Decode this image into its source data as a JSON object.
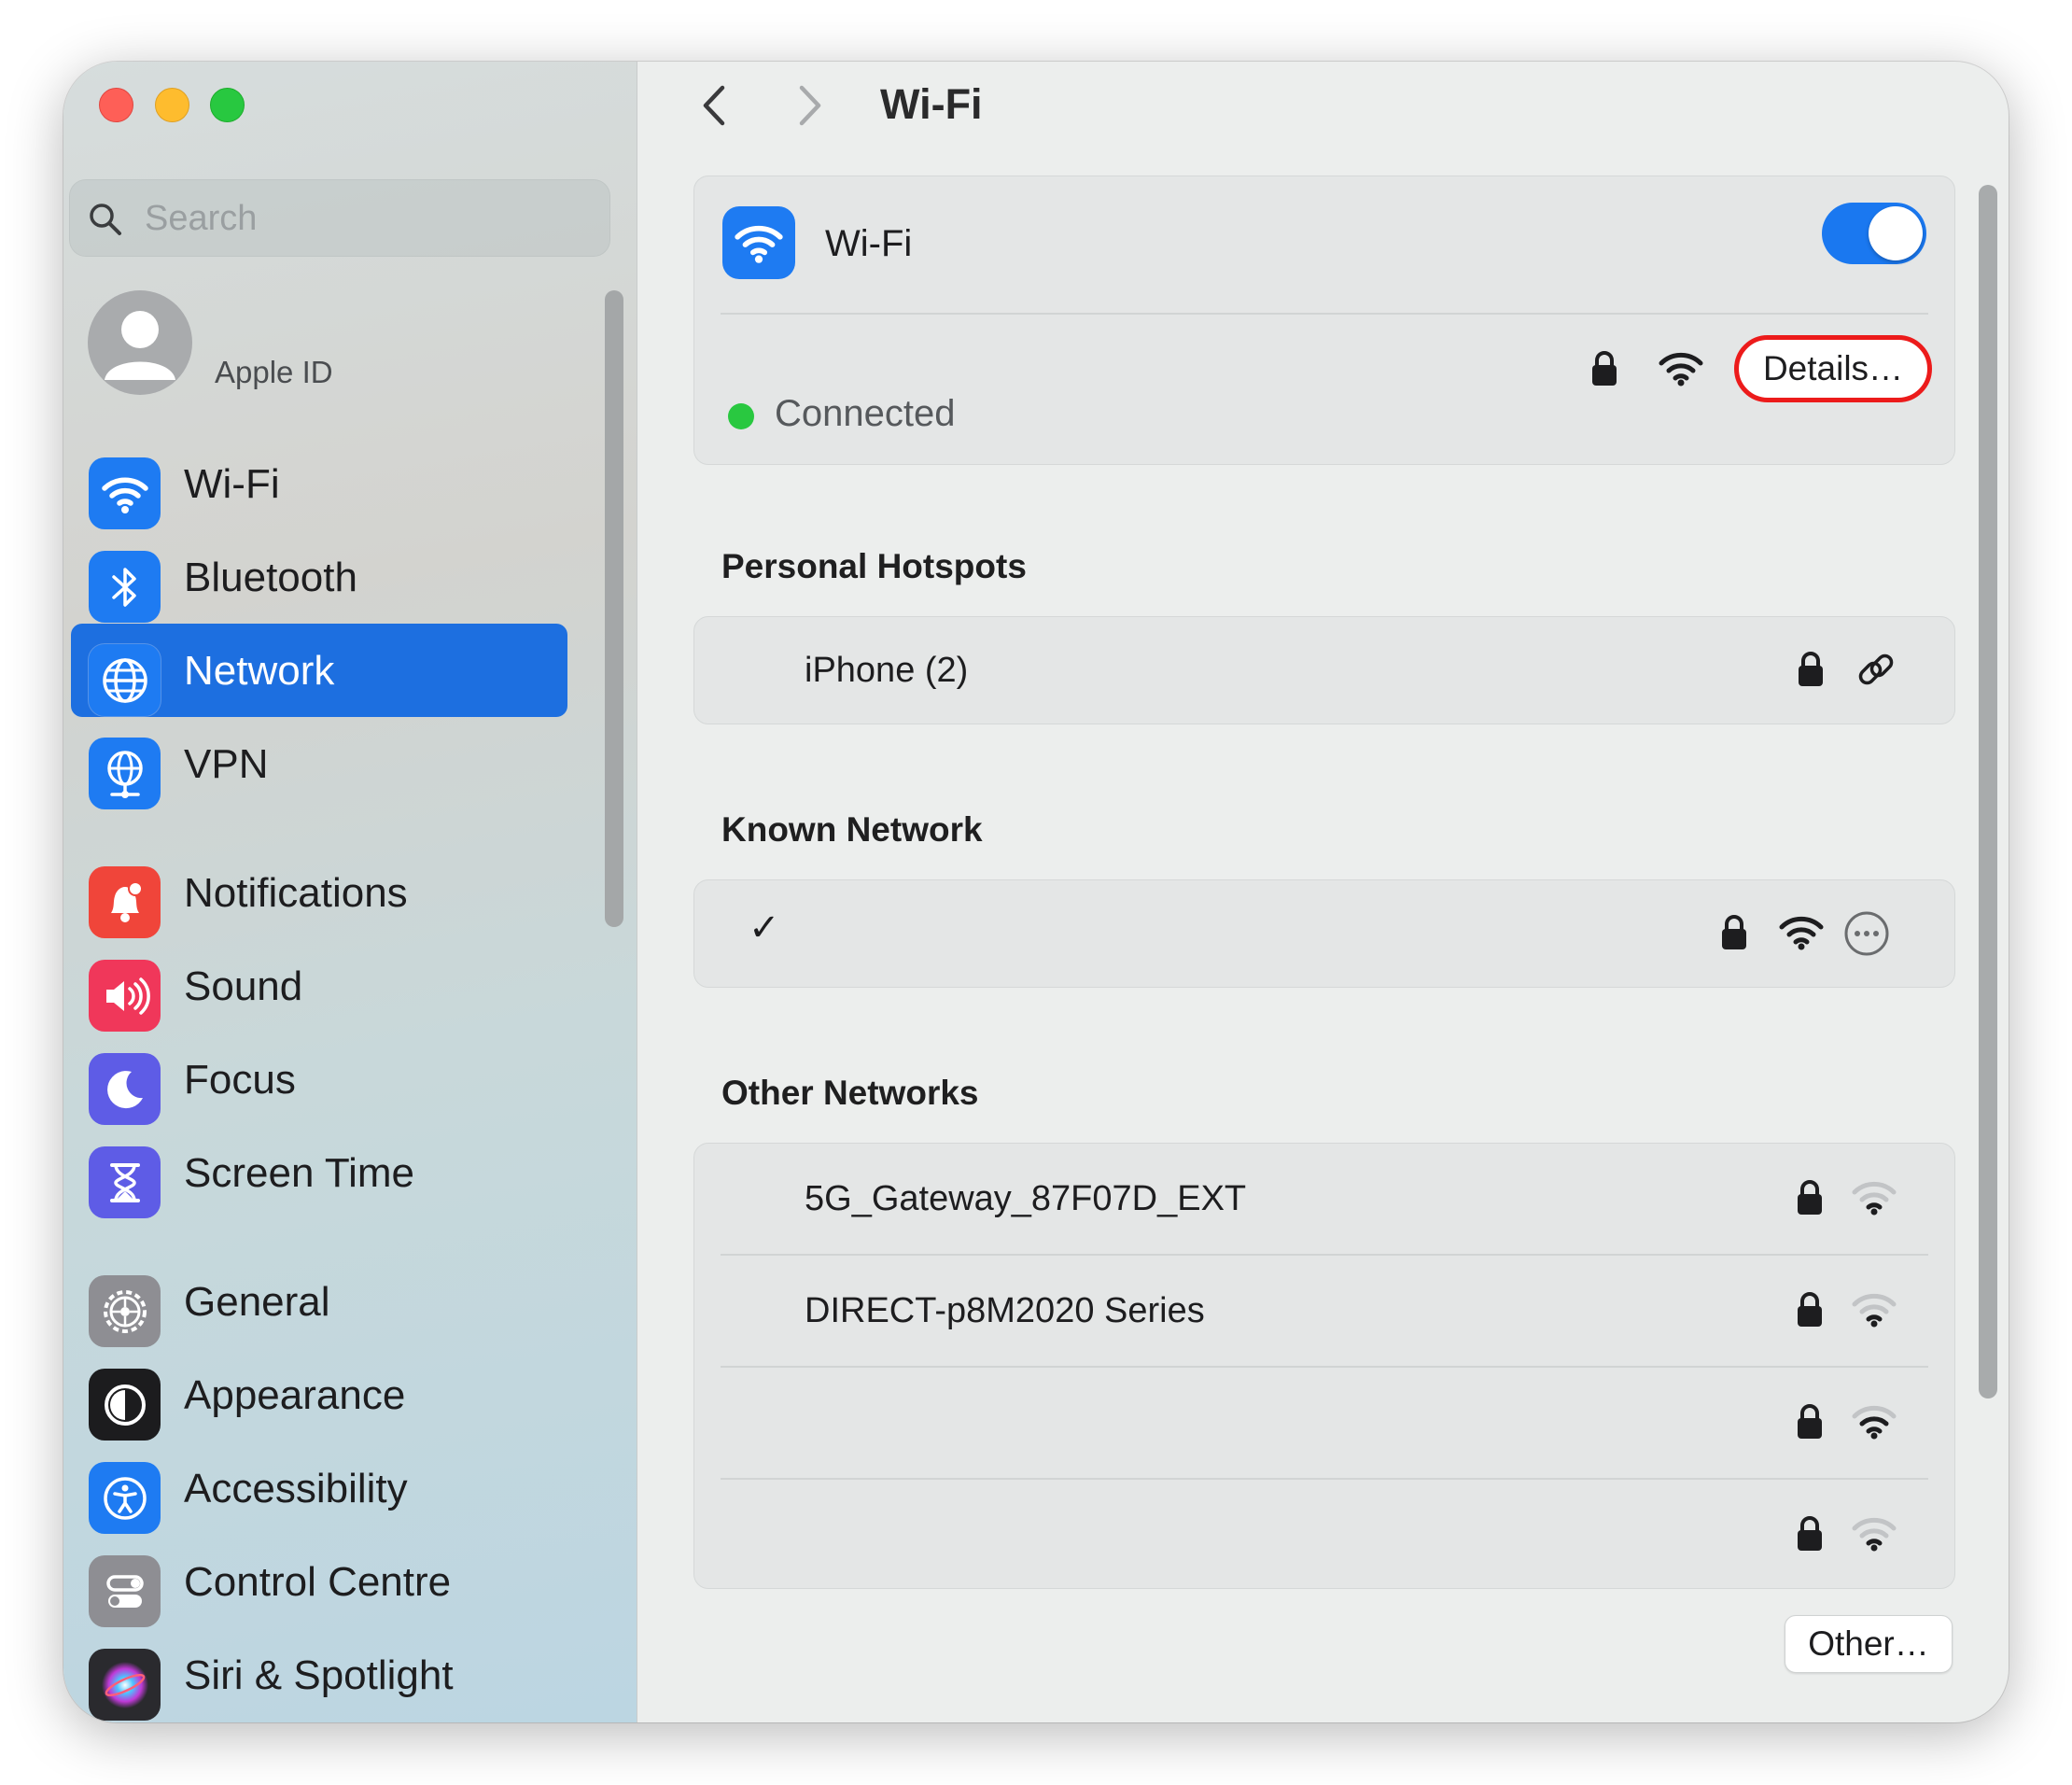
{
  "search": {
    "placeholder": "Search"
  },
  "sidebar": {
    "apple_id_label": "Apple ID",
    "items": [
      {
        "label": "Wi-Fi",
        "icon": "wifi-icon",
        "color": "#1e7bf2",
        "selected": false
      },
      {
        "label": "Bluetooth",
        "icon": "bluetooth-icon",
        "color": "#1e7bf2",
        "selected": false
      },
      {
        "label": "Network",
        "icon": "globe-icon",
        "color": "#1e7bf2",
        "selected": true
      },
      {
        "label": "VPN",
        "icon": "vpn-globe-icon",
        "color": "#1e7bf2",
        "selected": false
      },
      {
        "label": "Notifications",
        "icon": "bell-icon",
        "color": "#f0453a",
        "selected": false
      },
      {
        "label": "Sound",
        "icon": "speaker-icon",
        "color": "#f0375a",
        "selected": false
      },
      {
        "label": "Focus",
        "icon": "moon-icon",
        "color": "#5e5ce6",
        "selected": false
      },
      {
        "label": "Screen Time",
        "icon": "hourglass-icon",
        "color": "#5e5ce6",
        "selected": false
      },
      {
        "label": "General",
        "icon": "gear-icon",
        "color": "#8e8e93",
        "selected": false
      },
      {
        "label": "Appearance",
        "icon": "appearance-icon",
        "color": "#1c1c1e",
        "selected": false
      },
      {
        "label": "Accessibility",
        "icon": "accessibility-icon",
        "color": "#1e7bf2",
        "selected": false
      },
      {
        "label": "Control Centre",
        "icon": "control-centre-icon",
        "color": "#8e8e93",
        "selected": false
      },
      {
        "label": "Siri & Spotlight",
        "icon": "siri-icon",
        "color": "#2a2a2e",
        "selected": false
      }
    ]
  },
  "header": {
    "title": "Wi-Fi"
  },
  "wifi_card": {
    "title": "Wi-Fi",
    "toggle_on": true,
    "status": "Connected",
    "status_color": "#29c840",
    "details_label": "Details…"
  },
  "personal_hotspots": {
    "heading": "Personal Hotspots",
    "items": [
      {
        "name": "iPhone (2)"
      }
    ]
  },
  "known_network": {
    "heading": "Known Network",
    "check": "✓"
  },
  "other_networks": {
    "heading": "Other Networks",
    "items": [
      {
        "name": "5G_Gateway_87F07D_EXT",
        "signal": "weak"
      },
      {
        "name": "DIRECT-p8M2020 Series",
        "signal": "weak"
      },
      {
        "name": "",
        "signal": "strong"
      },
      {
        "name": "",
        "signal": "weak"
      }
    ]
  },
  "footer": {
    "other_label": "Other…"
  },
  "colors": {
    "accent": "#1d6fe0",
    "highlight": "#ec1b1b"
  }
}
